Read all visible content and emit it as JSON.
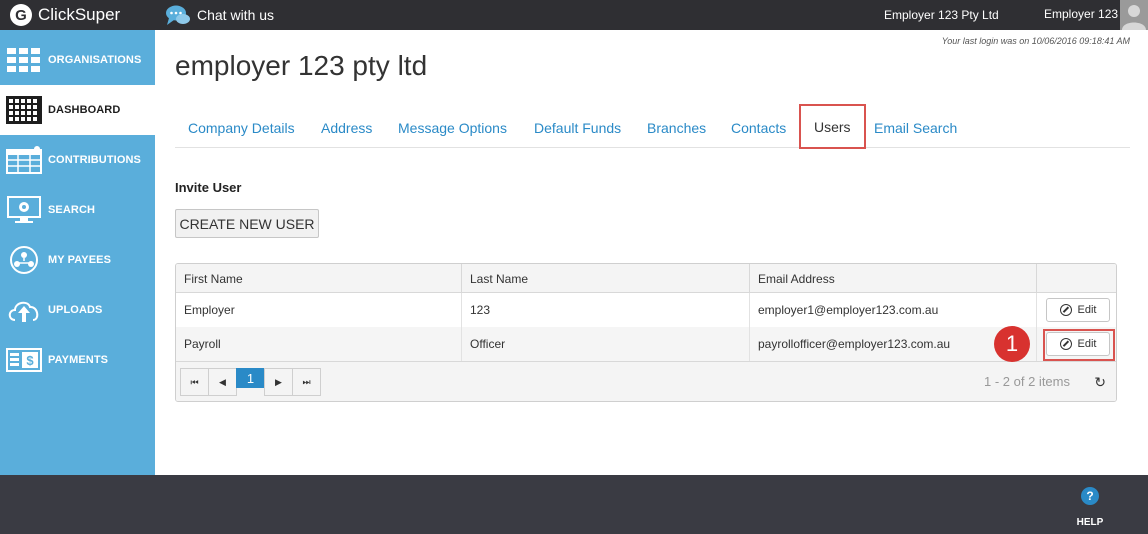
{
  "app": {
    "name": "ClickSuper"
  },
  "topbar": {
    "logo_letter": "G",
    "chat_label": "Chat with us",
    "company": "Employer 123 Pty Ltd",
    "user": "Employer 123"
  },
  "sidebar": {
    "items": [
      {
        "label": "ORGANISATIONS",
        "icon": "organisations-icon"
      },
      {
        "label": "DASHBOARD",
        "icon": "dashboard-icon",
        "active": true
      },
      {
        "label": "CONTRIBUTIONS",
        "icon": "contributions-icon"
      },
      {
        "label": "SEARCH",
        "icon": "search-icon"
      },
      {
        "label": "MY PAYEES",
        "icon": "payees-icon"
      },
      {
        "label": "UPLOADS",
        "icon": "upload-icon"
      },
      {
        "label": "PAYMENTS",
        "icon": "payments-icon"
      }
    ]
  },
  "main": {
    "last_login": "Your last login was on 10/06/2016 09:18:41 AM",
    "title": "employer 123 pty ltd",
    "tabs": [
      {
        "label": "Company Details"
      },
      {
        "label": "Address"
      },
      {
        "label": "Message Options"
      },
      {
        "label": "Default Funds"
      },
      {
        "label": "Branches"
      },
      {
        "label": "Contacts"
      },
      {
        "label": "Users",
        "active": true
      },
      {
        "label": "Email Search"
      }
    ],
    "invite_title": "Invite User",
    "create_button": "CREATE NEW USER"
  },
  "grid": {
    "columns": [
      "First Name",
      "Last Name",
      "Email Address"
    ],
    "rows": [
      {
        "first": "Employer",
        "last": "123",
        "email": "employer1@employer123.com.au",
        "action": "Edit"
      },
      {
        "first": "Payroll",
        "last": "Officer",
        "email": "payrollofficer@employer123.com.au",
        "action": "Edit"
      }
    ],
    "pager": {
      "first": "⏮",
      "prev": "◀",
      "current_page": "1",
      "next": "▶",
      "last": "⏭",
      "info": "1 - 2 of 2 items",
      "refresh": "↻"
    }
  },
  "callout": {
    "number": "1"
  },
  "footer": {
    "help_label": "HELP",
    "help_icon": "?"
  },
  "colors": {
    "topbar": "#2f2f33",
    "sidebar": "#5aaedb",
    "link": "#2a8ac7",
    "highlight": "#d9534f",
    "footer": "#3a3b43"
  }
}
